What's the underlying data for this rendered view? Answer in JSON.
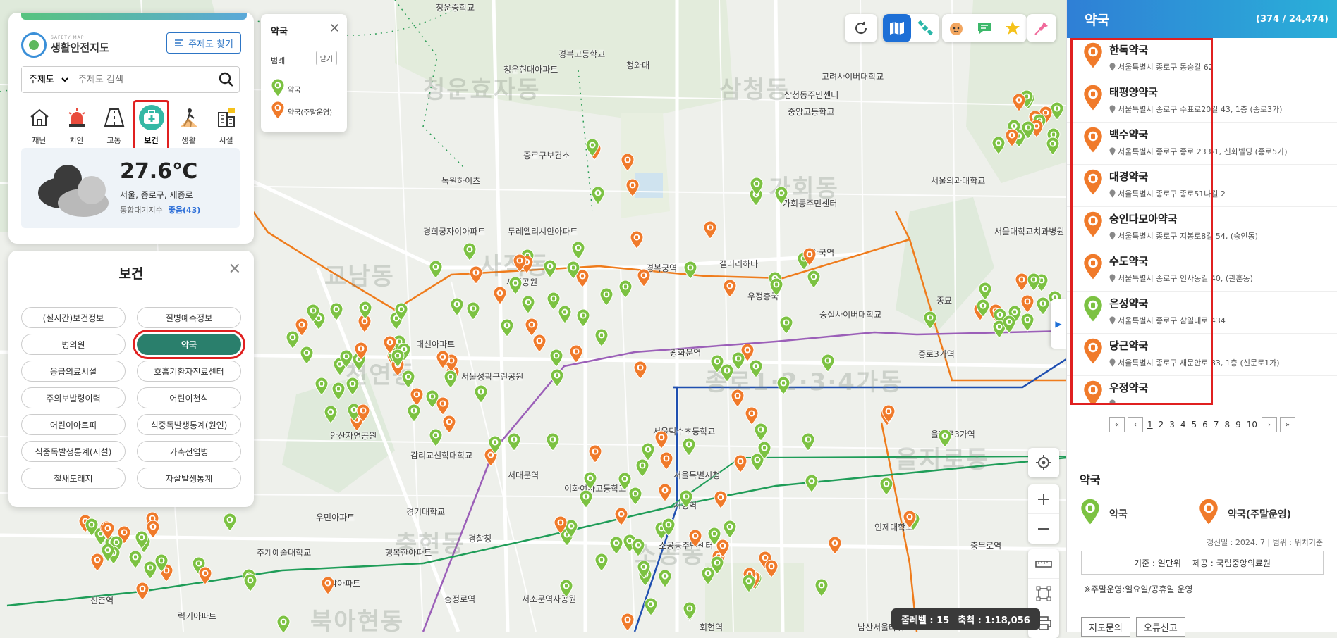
{
  "map": {
    "dong_labels": [
      "청운효자동",
      "삼청동",
      "사직동",
      "가회동",
      "교남동",
      "천연동",
      "종로1·2·3·4가동",
      "을지로동",
      "소공동",
      "충현동",
      "북아현동"
    ],
    "place_labels": [
      "청운중학교",
      "경복고등학교",
      "청와대",
      "청운현대아파트",
      "고려사이버대학교",
      "삼청동주민센터",
      "중앙고등학교",
      "종로구보건소",
      "녹원하이츠",
      "가회동주민센터",
      "경희궁자이아파트",
      "두레엘리시안아파트",
      "안국역",
      "서울의과대학교",
      "서울대학교치과병원",
      "갤러리하다",
      "경복궁역",
      "사직공원",
      "우정총국",
      "광화문역",
      "종로3가역",
      "숭실사이버대학교",
      "대신아파트",
      "서울성곽근린공원",
      "종묘",
      "서울덕수초등학교",
      "감리교신학대학교",
      "안산자연공원",
      "서대문역",
      "이화여자고등학교",
      "서울특별시청",
      "시청역",
      "경기대학교",
      "경찰청",
      "우민아파트",
      "추계예술대학교",
      "행복한아파트",
      "경남아파트",
      "소공동주민센터",
      "신촌역",
      "럭키아파트",
      "충정로역",
      "서소문역사공원",
      "회현역",
      "남산서울타워",
      "을지로3가역",
      "충무로역",
      "인제대학교"
    ],
    "zoom_level_label": "줌레벨 : 15",
    "scale_label": "축척 : 1:18,056"
  },
  "main_panel": {
    "logo_text": "생활안전지도",
    "logo_sub": "SAFETY MAP",
    "theme_button": "주제도 찾기",
    "search_select": "주제도",
    "search_placeholder": "주제도 검색",
    "categories": [
      {
        "label": "재난",
        "icon": "house-disaster-icon"
      },
      {
        "label": "치안",
        "icon": "siren-icon"
      },
      {
        "label": "교통",
        "icon": "road-icon"
      },
      {
        "label": "보건",
        "icon": "first-aid-kit-icon"
      },
      {
        "label": "생활",
        "icon": "hiking-icon"
      },
      {
        "label": "시설",
        "icon": "building-icon"
      }
    ],
    "weather": {
      "temp": "27.6℃",
      "location": "서울, 종로구, 세종로",
      "aq_label": "통합대기지수",
      "aq_value": "좋음(43)"
    }
  },
  "legend_popup": {
    "title": "약국",
    "subtitle": "범례",
    "hide": "닫기",
    "items": [
      "약국",
      "약국(주말운영)"
    ]
  },
  "health_panel": {
    "title": "보건",
    "chips": [
      "(실시간)보건정보",
      "질병예측정보",
      "병의원",
      "약국",
      "응급의료시설",
      "호흡기환자진료센터",
      "주의보발령이력",
      "어린이천식",
      "어린이아토피",
      "식중독발생통계(원인)",
      "식중독발생통계(시설)",
      "가축전염병",
      "철새도래지",
      "자살발생통계"
    ]
  },
  "right_panel": {
    "title": "약국",
    "count": "(374 / 24,474)",
    "items": [
      {
        "name": "한독약국",
        "addr": "서울특별시 종로구 동숭길 62",
        "type": "weekend"
      },
      {
        "name": "태평양약국",
        "addr": "서울특별시 종로구 수표로20길 43, 1층 (종로3가)",
        "type": "weekend"
      },
      {
        "name": "백수약국",
        "addr": "서울특별시 종로구 종로 233-1, 신화빌딩 (종로5가)",
        "type": "weekend"
      },
      {
        "name": "대경약국",
        "addr": "서울특별시 종로구 종로51나길 2",
        "type": "weekend"
      },
      {
        "name": "숭인다모아약국",
        "addr": "서울특별시 종로구 지봉로8길 54, (숭인동)",
        "type": "weekend"
      },
      {
        "name": "수도약국",
        "addr": "서울특별시 종로구 인사동길 40, (관훈동)",
        "type": "weekend"
      },
      {
        "name": "은성약국",
        "addr": "서울특별시 종로구 삼일대로 434",
        "type": "normal"
      },
      {
        "name": "당근약국",
        "addr": "서울특별시 종로구 새문안로 83, 1층 (신문로1가)",
        "type": "weekend"
      },
      {
        "name": "우정약국",
        "addr": "",
        "type": "weekend"
      }
    ],
    "pages": [
      "1",
      "2",
      "3",
      "4",
      "5",
      "6",
      "7",
      "8",
      "9",
      "10"
    ],
    "legend_title": "약국",
    "legend_items": [
      "약국",
      "약국(주말운영)"
    ],
    "meta": "갱신일 : 2024. 7   |   범위 : 위치기준",
    "source_base": "기준 : 일단위",
    "source_provider": "제공 : 국립중앙의료원",
    "note": "※주말운영:일요일/공휴일 운영",
    "buttons": [
      "지도문의",
      "오류신고"
    ]
  },
  "colors": {
    "normal_pin": "#7cc242",
    "weekend_pin": "#f07a2a",
    "accent": "#2a7f6c",
    "highlight": "#e02020"
  }
}
